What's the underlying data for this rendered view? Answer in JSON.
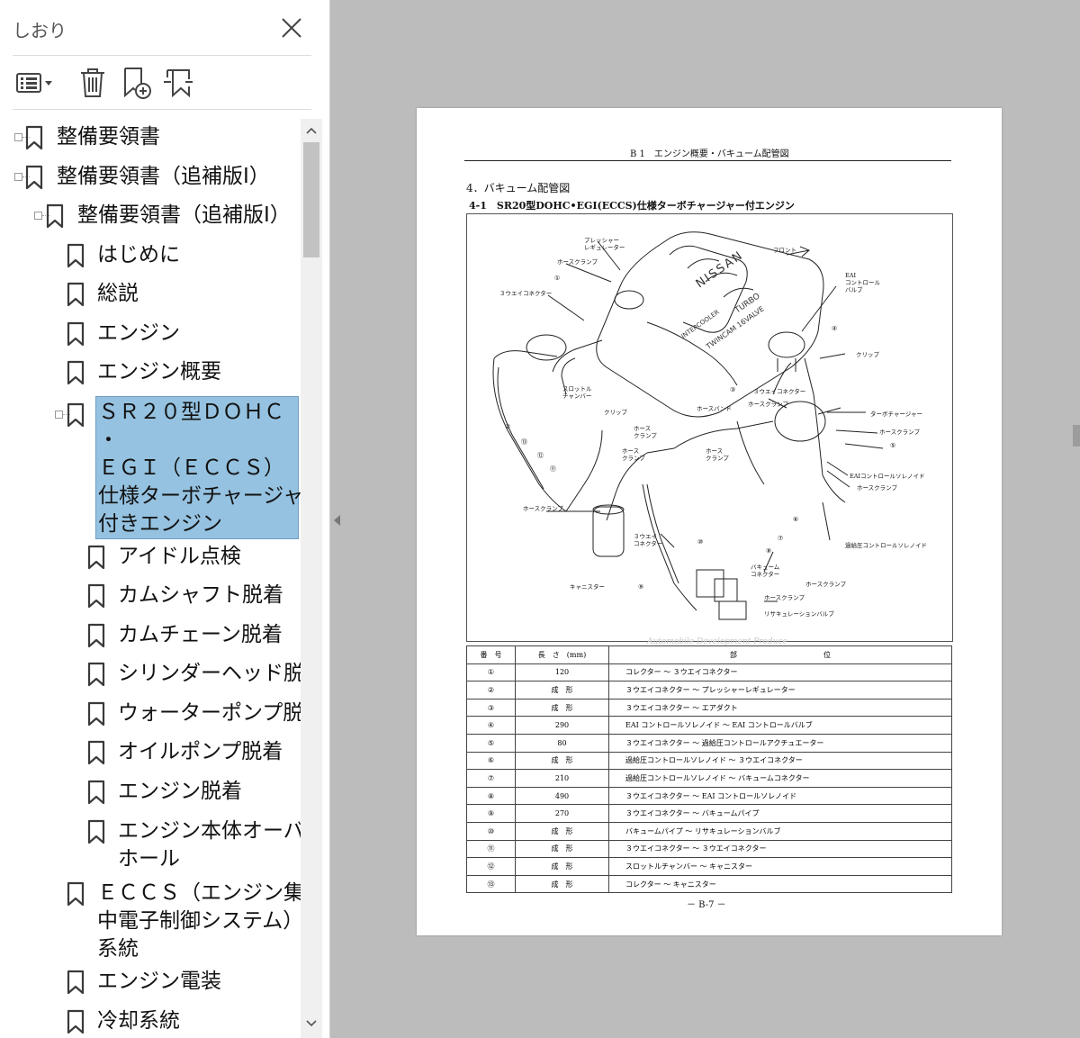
{
  "sidebar": {
    "title": "しおり",
    "close_icon": "close-icon",
    "toolbar": [
      {
        "name": "options-menu-button",
        "icon": "list-options-icon"
      },
      {
        "name": "delete-bookmark-button",
        "icon": "trash-icon"
      },
      {
        "name": "new-bookmark-button",
        "icon": "bookmark-add-icon"
      },
      {
        "name": "find-bookmark-button",
        "icon": "bookmark-search-icon"
      }
    ],
    "items": [
      {
        "label": "整備要領書"
      },
      {
        "label": "整備要領書（追補版Ⅰ）"
      },
      {
        "label": "整備要領書（追補版Ⅰ）"
      },
      {
        "label": "はじめに"
      },
      {
        "label": "総説"
      },
      {
        "label": "エンジン"
      },
      {
        "label": "エンジン概要"
      },
      {
        "label_lines": [
          "ＳＲ２０型ＤＯＨＣ",
          "・",
          "ＥＧＩ（ＥＣＣＳ）",
          "仕様ターボチャージャー",
          "付きエンジン"
        ]
      },
      {
        "label": "アイドル点検"
      },
      {
        "label": "カムシャフト脱着"
      },
      {
        "label": "カムチェーン脱着"
      },
      {
        "label": "シリンダーヘッド脱着"
      },
      {
        "label": "ウォーターポンプ脱着"
      },
      {
        "label": "オイルポンプ脱着"
      },
      {
        "label": "エンジン脱着"
      },
      {
        "label_lines": [
          "エンジン本体オーバー",
          "ホール"
        ]
      },
      {
        "label_lines": [
          "ＥＣＣＳ（エンジン集",
          "中電子制御システム）",
          "系統"
        ]
      },
      {
        "label": "エンジン電装"
      },
      {
        "label": "冷却系統"
      }
    ]
  },
  "document": {
    "header": "B 1　エンジン概要・バキューム配管図",
    "section": "4．バキューム配管図",
    "subsection": "4-1　SR20型DOHC•EGI(ECCS)仕様ターボチャージャー付エンジン",
    "diagram_labels": {
      "pressure_regulator": "プレッシャー\nレギュレーター",
      "hose_clamp_top": "ホースクランプ",
      "front": "フロント",
      "eai_valve": "EAI\nコントロール\nバルブ",
      "three_way": "３ウエイコネクター",
      "clip": "クリップ",
      "throttle": "スロットル\nチャンバー",
      "clip2": "クリップ",
      "hose_band": "ホースバンド",
      "three_way2": "３ウエイコネクター",
      "hose_clamp2": "ホースクランプ",
      "turbo": "ターボチャージャー",
      "hose_clamp3": "ホースクランプ",
      "hose_clamp4": "ホース\nクランプ",
      "hose_clamp5": "ホース\nクランプ",
      "hose_clamp6": "ホース\nクランプ",
      "eai_solenoid": "EAIコントロールソレノイド",
      "hose_clamp7": "ホースクランプ",
      "hose_clamp8": "ホースクランプ",
      "three_way3": "３ウエイ\nコネクター",
      "boost_solenoid": "過給圧コントロールソレノイド",
      "canister": "キャニスター",
      "vacuum_connector": "バキューム\nコネクター",
      "hose_clamp9": "ホースクランプ",
      "hose_clamp10": "ホースクランプ",
      "recirc_valve": "リサキュレーションバルブ",
      "n1": "①",
      "n2": "②",
      "n3": "③",
      "n4": "④",
      "n5": "⑤",
      "n6": "⑥",
      "n7": "⑦",
      "n8": "⑧",
      "n9": "⑨",
      "n10": "⑩",
      "n11": "⑪",
      "n12": "⑫",
      "n13": "⑬",
      "watermark": "Automobile Development Produce"
    },
    "table": {
      "headers": [
        "番　号",
        "長　さ　(mm)",
        "部　　　　　　　　　　　　位"
      ],
      "rows": [
        [
          "①",
          "120",
          "コレクター ～ ３ウエイコネクター"
        ],
        [
          "②",
          "成　形",
          "３ウエイコネクター ～ プレッシャーレギュレーター"
        ],
        [
          "③",
          "成　形",
          "３ウエイコネクター ～ エアダクト"
        ],
        [
          "④",
          "290",
          "EAI コントロールソレノイド ～ EAI コントロールバルブ"
        ],
        [
          "⑤",
          "80",
          "３ウエイコネクター ～ 過給圧コントロールアクチュエーター"
        ],
        [
          "⑥",
          "成　形",
          "過給圧コントロールソレノイド ～ ３ウエイコネクター"
        ],
        [
          "⑦",
          "210",
          "過給圧コントロールソレノイド ～ バキュームコネクター"
        ],
        [
          "⑧",
          "490",
          "３ウエイコネクター ～ EAI コントロールソレノイド"
        ],
        [
          "⑨",
          "270",
          "３ウエイコネクター ～ バキュームパイプ"
        ],
        [
          "⑩",
          "成　形",
          "バキュームパイプ ～ リサキュレーションバルブ"
        ],
        [
          "⑪",
          "成　形",
          "３ウエイコネクター ～ ３ウエイコネクター"
        ],
        [
          "⑫",
          "成　形",
          "スロットルチャンバー ～ キャニスター"
        ],
        [
          "⑬",
          "成　形",
          "コレクター ～ キャニスター"
        ]
      ]
    },
    "footer": "－ B-7 －"
  }
}
